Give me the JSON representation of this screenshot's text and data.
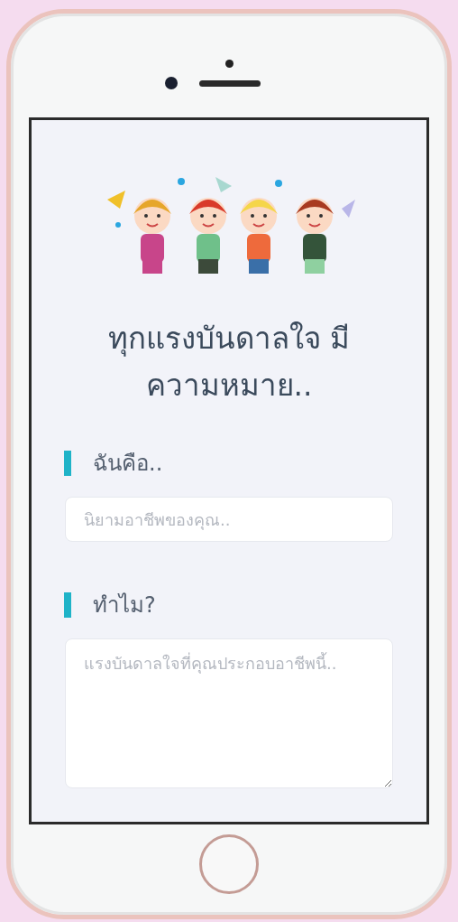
{
  "heading": "ทุกแรงบันดาลใจ มีความหมาย..",
  "fields": [
    {
      "kind": "input",
      "label": "ฉันคือ..",
      "placeholder": "นิยามอาชีพของคุณ.."
    },
    {
      "kind": "textarea",
      "label": "ทำไม?",
      "placeholder": "แรงบันดาลใจที่คุณประกอบอาชีพนี้.."
    }
  ]
}
